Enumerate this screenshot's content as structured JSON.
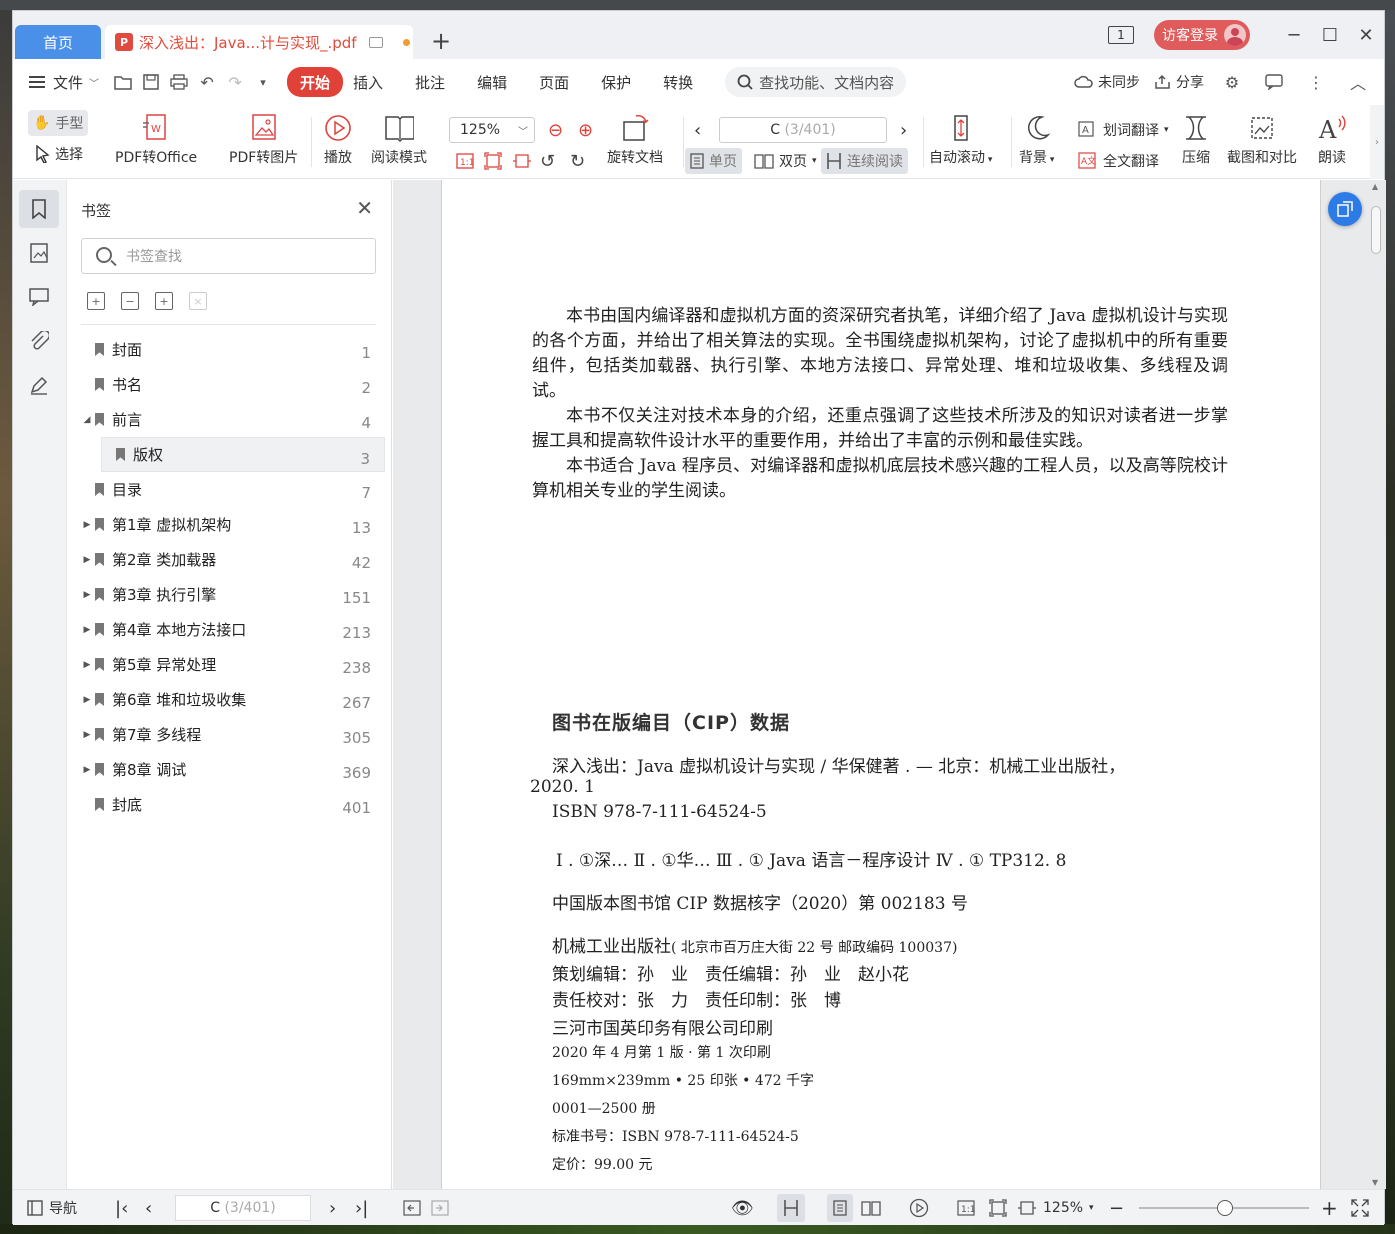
{
  "titlebar": {
    "home_tab": "首页",
    "doc_tab": "深入浅出：Java...计与实现_.pdf",
    "page_indicator": "1",
    "login": "访客登录"
  },
  "menubar": {
    "file": "文件",
    "tabs": [
      "开始",
      "插入",
      "批注",
      "编辑",
      "页面",
      "保护",
      "转换"
    ],
    "search": "查找功能、文档内容",
    "sync": "未同步",
    "share": "分享"
  },
  "ribbon": {
    "hand": "手型",
    "select": "选择",
    "pdf_to_office": "PDF转Office",
    "pdf_to_image": "PDF转图片",
    "play": "播放",
    "read_mode": "阅读模式",
    "zoom": "125%",
    "rotate_doc": "旋转文档",
    "page_current": "C",
    "page_total": "(3/401)",
    "single_page": "单页",
    "double_page": "双页",
    "continuous": "连续阅读",
    "auto_scroll": "自动滚动",
    "background": "背景",
    "word_translate": "划词翻译",
    "full_translate": "全文翻译",
    "compress": "压缩",
    "screenshot_compare": "截图和对比",
    "read_aloud": "朗读"
  },
  "panel": {
    "title": "书签",
    "search_placeholder": "书签查找",
    "bookmarks": [
      {
        "label": "封面",
        "page": "1",
        "arrow": ""
      },
      {
        "label": "书名",
        "page": "2",
        "arrow": ""
      },
      {
        "label": "前言",
        "page": "4",
        "arrow": "◢"
      },
      {
        "label": "版权",
        "page": "3",
        "arrow": ""
      },
      {
        "label": "目录",
        "page": "7",
        "arrow": ""
      },
      {
        "label": "第1章 虚拟机架构",
        "page": "13",
        "arrow": "▶"
      },
      {
        "label": "第2章 类加载器",
        "page": "42",
        "arrow": "▶"
      },
      {
        "label": "第3章 执行引擎",
        "page": "151",
        "arrow": "▶"
      },
      {
        "label": "第4章 本地方法接口",
        "page": "213",
        "arrow": "▶"
      },
      {
        "label": "第5章 异常处理",
        "page": "238",
        "arrow": "▶"
      },
      {
        "label": "第6章 堆和垃圾收集",
        "page": "267",
        "arrow": "▶"
      },
      {
        "label": "第7章 多线程",
        "page": "305",
        "arrow": "▶"
      },
      {
        "label": "第8章 调试",
        "page": "369",
        "arrow": "▶"
      },
      {
        "label": "封底",
        "page": "401",
        "arrow": ""
      }
    ]
  },
  "document": {
    "para1": "本书由国内编译器和虚拟机方面的资深研究者执笔，详细介绍了 Java 虚拟机设计与实现的各个方面，并给出了相关算法的实现。全书围绕虚拟机架构，讨论了虚拟机中的所有重要组件，包括类加载器、执行引擎、本地方法接口、异常处理、堆和垃圾收集、多线程及调试。",
    "para2": "本书不仅关注对技术本身的介绍，还重点强调了这些技术所涉及的知识对读者进一步掌握工具和提高软件设计水平的重要作用，并给出了丰富的示例和最佳实践。",
    "para3": "本书适合 Java 程序员、对编译器和虚拟机底层技术感兴趣的工程人员，以及高等院校计算机相关专业的学生阅读。",
    "cip_title": "图书在版编目（CIP）数据",
    "cip_line1": "深入浅出：Java 虚拟机设计与实现 / 华保健著 . — 北京：机械工业出版社，",
    "cip_line2": "2020. 1",
    "cip_isbn": "ISBN 978-7-111-64524-5",
    "cip_class": "Ⅰ . ①深…  Ⅱ . ①华…  Ⅲ . ① Java 语言－程序设计  Ⅳ . ① TP312. 8",
    "cip_record": "中国版本图书馆 CIP 数据核字（2020）第 002183 号",
    "publisher": "机械工业出版社",
    "publisher_addr": "( 北京市百万庄大街 22 号   邮政编码 100037)",
    "editors": "策划编辑：孙　业　责任编辑：孙　业　赵小花",
    "proof": "责任校对：张　力　责任印制：张　博",
    "printer": "三河市国英印务有限公司印刷",
    "edition": "2020 年 4 月第 1 版 · 第 1 次印刷",
    "format": "169mm×239mm • 25 印张 • 472 千字",
    "copies": "0001—2500 册",
    "std_isbn": "标准书号：ISBN 978-7-111-64524-5",
    "price": "定价：99.00 元"
  },
  "statusbar": {
    "nav": "导航",
    "page_current": "C",
    "page_total": "(3/401)",
    "zoom": "125%"
  },
  "colors": {
    "accent": "#4a8fe8",
    "brand_red": "#e0423a",
    "login": "#e05c5c"
  }
}
